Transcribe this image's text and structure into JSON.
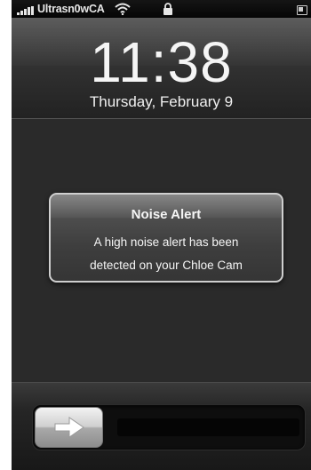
{
  "status_bar": {
    "carrier": "Ultrasn0wCA",
    "icons": [
      "signal-bars-icon",
      "wifi-icon",
      "lock-icon",
      "battery-icon"
    ]
  },
  "lock_screen": {
    "time": "11:38",
    "date": "Thursday, February 9"
  },
  "alert": {
    "title": "Noise Alert",
    "message_line1": "A high noise alert has been",
    "message_line2": "detected on your Chloe Cam"
  },
  "unlock_slider": {
    "knob_icon": "right-arrow-icon",
    "label": ""
  }
}
